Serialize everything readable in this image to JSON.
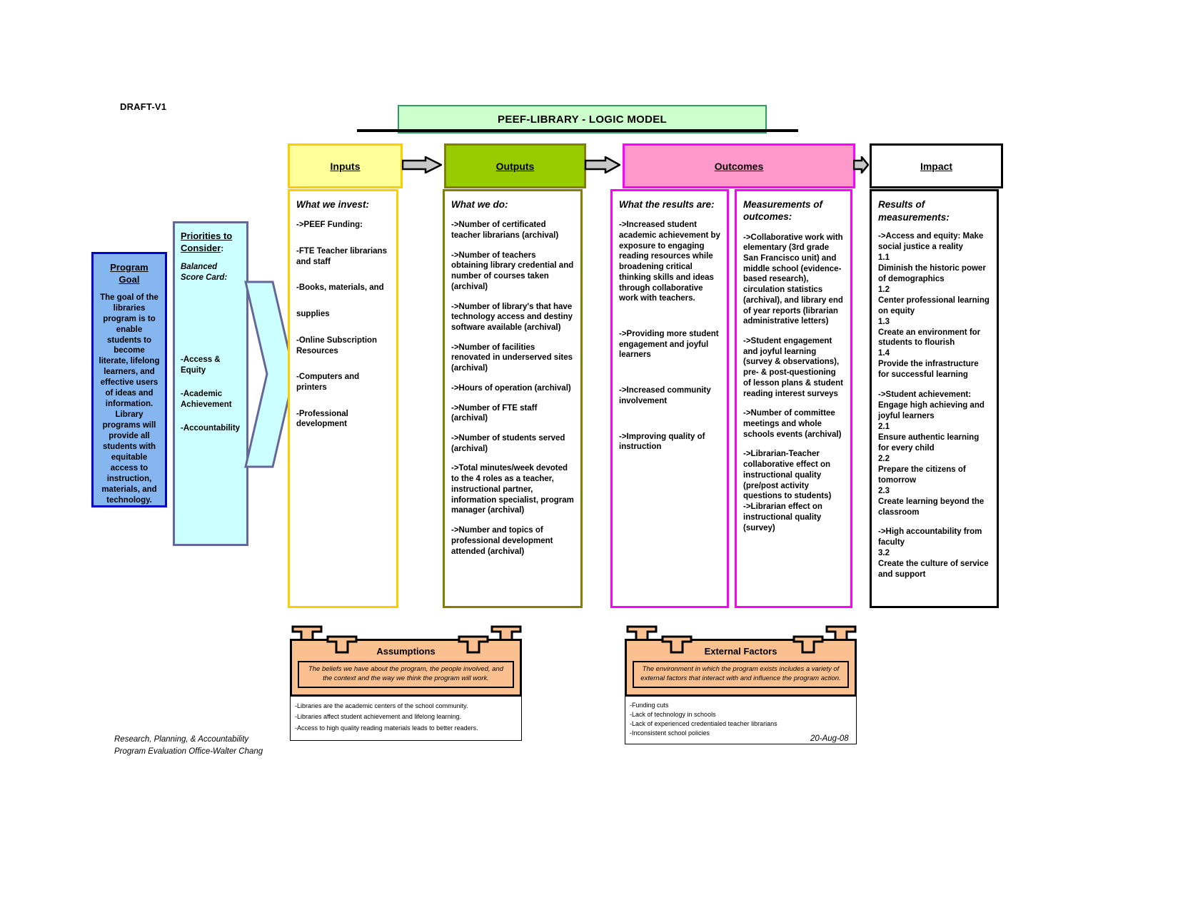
{
  "draft_label": "DRAFT-V1",
  "title": "PEEF-LIBRARY - LOGIC MODEL",
  "headers": {
    "inputs": "Inputs",
    "outputs": "Outputs",
    "outcomes": "Outcomes",
    "impact": "Impact"
  },
  "colors": {
    "title_fill": "#ccffcc",
    "title_border": "#2e9b63",
    "inputs_fill": "#ffff99",
    "inputs_border": "#ffcc00",
    "outputs_fill": "#99cc00",
    "outputs_border": "#808000",
    "outcomes_fill": "#ff99cc",
    "outcomes_border": "#ff00ff",
    "impact_fill": "#ffffff",
    "impact_border": "#000000",
    "goal_fill": "#85b6ef",
    "goal_border": "#0000cc",
    "priorities_fill": "#ccffff",
    "priorities_border": "#666699",
    "banner_fill": "#fac090"
  },
  "goal": {
    "title_line1": "Program",
    "title_line2": "Goal",
    "body": "The goal of the libraries program is to enable students to become literate, lifelong learners, and effective users of ideas and information. Library programs will provide all students with equitable access to instruction, materials, and technology."
  },
  "priorities": {
    "title_line1": "Priorities to",
    "title_line2": "Consider",
    "title_colon": ":",
    "subtitle": "Balanced Score Card:",
    "items": [
      "-Access & Equity",
      "-Academic Achievement",
      "-Accountability"
    ]
  },
  "inputs": {
    "heading": "What we invest:",
    "items": [
      "->PEEF Funding:",
      "-FTE Teacher librarians and staff",
      "-Books, materials, and",
      "supplies",
      "-Online Subscription Resources",
      "-Computers and printers",
      "-Professional development"
    ]
  },
  "outputs": {
    "heading": "What we do:",
    "items": [
      "->Number of certificated teacher librarians  (archival)",
      "->Number of teachers obtaining library credential and number of courses taken (archival)",
      " ->Number of library's that have technology access and destiny software available (archival)",
      "->Number of facilities renovated in underserved sites (archival)",
      "->Hours of operation (archival)",
      "->Number of FTE staff (archival)",
      "->Number of students served (archival)",
      "->Total minutes/week devoted to the 4 roles as a teacher, instructional partner, information specialist, program manager (archival)",
      "->Number and topics of professional development attended (archival)"
    ]
  },
  "results": {
    "heading": "What the results are:",
    "items": [
      "->Increased student academic achievement by exposure to engaging reading resources while broadening critical thinking skills and ideas through collaborative work with teachers.",
      "->Providing more student engagement and joyful learners",
      "->Increased community involvement",
      "->Improving quality of instruction"
    ]
  },
  "measures": {
    "heading_line1": "Measurements of",
    "heading_line2": "outcomes:",
    "items": [
      "->Collaborative work with elementary (3rd grade San Francisco unit) and middle school (evidence-based research), circulation statistics (archival),  and library end of year reports (librarian administrative letters)",
      "->Student engagement and joyful learning (survey & observations), pre- & post-questioning of lesson plans & student reading interest surveys",
      "->Number of committee meetings and whole schools events (archival)",
      "->Librarian-Teacher collaborative effect on instructional quality (pre/post activity questions to students)",
      "->Librarian effect on instructional quality (survey)"
    ]
  },
  "impact": {
    "heading": "Results of measurements:",
    "groups": [
      {
        "lead": "->Access and equity: Make social justice a reality",
        "subs": [
          {
            "num": "1.1",
            "text": "Diminish the historic power of demographics"
          },
          {
            "num": "1.2",
            "text": "Center professional learning on equity"
          },
          {
            "num": "1.3",
            "text": "Create an environment for students to flourish"
          },
          {
            "num": "1.4",
            "text": "Provide the infrastructure for successful learning"
          }
        ]
      },
      {
        "lead": "->Student achievement: Engage high achieving and joyful learners",
        "subs": [
          {
            "num": "2.1",
            "text": "Ensure authentic learning for every child"
          },
          {
            "num": "2.2",
            "text": "Prepare the citizens of tomorrow"
          },
          {
            "num": "2.3",
            "text": "Create learning beyond the classroom"
          }
        ]
      },
      {
        "lead": "->High accountability from faculty",
        "subs": [
          {
            "num": "3.2",
            "text": "Create the culture of service and support"
          }
        ]
      }
    ]
  },
  "assumptions": {
    "title": "Assumptions",
    "subtitle": "The beliefs we have about the program, the people involved, and the context and the way we think the program will work.",
    "items": [
      "-Libraries are the academic centers of the school community.",
      "-Libraries affect student achievement and lifelong learning.",
      "-Access to high quality reading materials leads to better readers."
    ]
  },
  "external_factors": {
    "title": "External Factors",
    "subtitle": "The environment in which the program exists includes a variety of external factors that interact with and influence the program action.",
    "items": [
      "-Funding cuts",
      "-Lack of technology in schools",
      "-Lack of experienced credentialed teacher librarians",
      "-Inconsistent school policies"
    ]
  },
  "footer": {
    "line1": "Research, Planning, & Accountability",
    "line2": "Program Evaluation Office-Walter Chang",
    "date": "20-Aug-08"
  }
}
